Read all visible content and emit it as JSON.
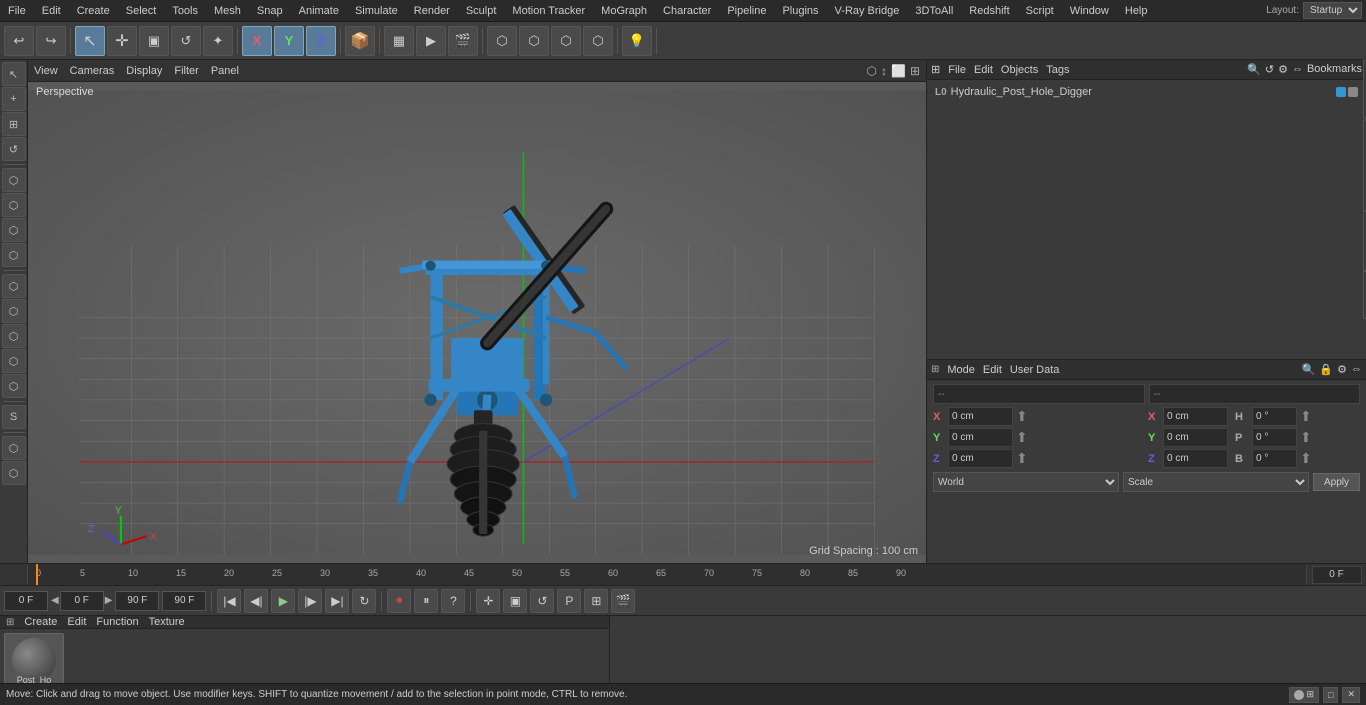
{
  "menuBar": {
    "items": [
      "File",
      "Edit",
      "Create",
      "Select",
      "Tools",
      "Mesh",
      "Snap",
      "Animate",
      "Simulate",
      "Render",
      "Sculpt",
      "Motion Tracker",
      "MoGraph",
      "Character",
      "Pipeline",
      "Plugins",
      "V-Ray Bridge",
      "3DToAll",
      "Redshift",
      "Script",
      "Window",
      "Help"
    ],
    "layout_label": "Layout:",
    "layout_value": "Startup"
  },
  "toolbar": {
    "undo_icon": "↩",
    "redo_icon": "↪",
    "buttons": [
      "↖",
      "+",
      "□",
      "↺",
      "✦",
      "X",
      "Y",
      "Z",
      "📦",
      "⟳",
      "☁",
      "▶",
      "⬜",
      "⏹",
      "⬡",
      "⚙",
      "●",
      "✦",
      "⬡",
      "⬡",
      "⬡",
      "⟳",
      "P",
      "⊞",
      "⬜"
    ]
  },
  "viewport": {
    "header_items": [
      "View",
      "Cameras",
      "Display",
      "Filter",
      "Panel"
    ],
    "perspective_label": "Perspective",
    "grid_spacing": "Grid Spacing : 100 cm"
  },
  "leftToolbar": {
    "buttons": [
      "↖",
      "+",
      "⊞",
      "⟳",
      "⬡",
      "⬡",
      "⬡",
      "⬡",
      "⬡",
      "⬡",
      "⬡",
      "⬡",
      "⬡",
      "⬡",
      "⬡",
      "⬡",
      "⬡",
      "⬡",
      "⬡",
      "⬡",
      "⬡",
      "⬡"
    ]
  },
  "objectsPanel": {
    "header_items": [
      "File",
      "Edit",
      "Objects",
      "Tags",
      "Bookmarks"
    ],
    "objects": [
      {
        "name": "Hydraulic_Post_Hole_Digger",
        "icon": "L0",
        "dot1": "#3399cc",
        "dot2": "#888888"
      }
    ]
  },
  "attributesPanel": {
    "header_items": [
      "Mode",
      "Edit",
      "User Data"
    ],
    "coord_header": "--",
    "coords": [
      {
        "label": "X",
        "val1": "0 cm",
        "val2": "0 cm",
        "extra": "H",
        "extra_val": "0 °"
      },
      {
        "label": "Y",
        "val1": "0 cm",
        "val2": "0 cm",
        "extra": "P",
        "extra_val": "0 °"
      },
      {
        "label": "Z",
        "val1": "0 cm",
        "val2": "0 cm",
        "extra": "B",
        "extra_val": "0 °"
      }
    ]
  },
  "rightTabs": [
    "Structure",
    "Content Browser"
  ],
  "sideTab": [
    "Attributes",
    "Layers"
  ],
  "timeline": {
    "markers": [
      "0",
      "5",
      "10",
      "15",
      "20",
      "25",
      "30",
      "35",
      "40",
      "45",
      "50",
      "55",
      "60",
      "65",
      "70",
      "75",
      "80",
      "85",
      "90"
    ],
    "current_frame": "0 F",
    "start_frame": "0 F",
    "end_frame": "90 F",
    "end2": "90 F"
  },
  "playback": {
    "frame_display": "0 F",
    "start_frame": "0 F",
    "end_frame": "90 F",
    "end2_frame": "90 F"
  },
  "materialPanel": {
    "header_items": [
      "Create",
      "Edit",
      "Function",
      "Texture"
    ],
    "material_name": "Post_Ho"
  },
  "bottomBar": {
    "world_label": "World",
    "scale_label": "Scale",
    "apply_label": "Apply"
  },
  "statusBar": {
    "text": "Move: Click and drag to move object. Use modifier keys. SHIFT to quantize movement / add to the selection in point mode, CTRL to remove.",
    "mode_btn1": "●",
    "mode_btn2": "□",
    "mode_btn3": "✕"
  }
}
